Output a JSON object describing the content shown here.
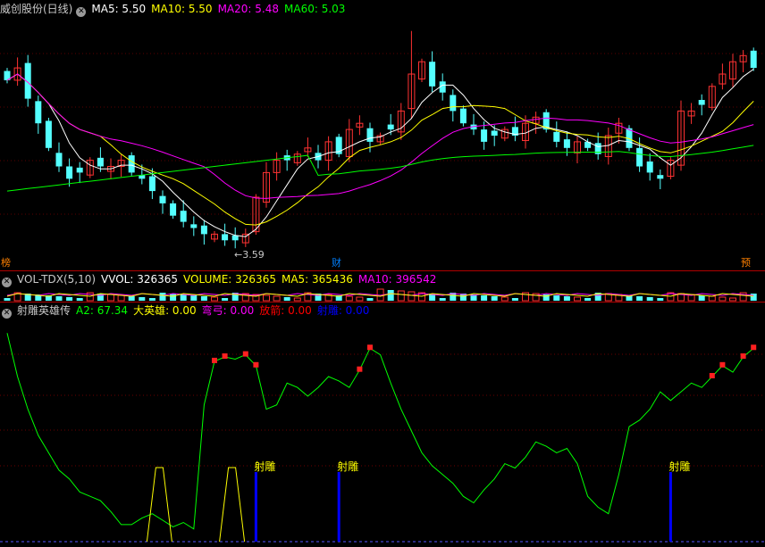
{
  "main": {
    "title": "威创股份(日线)",
    "indicators": [
      {
        "label": "MA5: 5.50",
        "color": "#ffffff"
      },
      {
        "label": "MA10: 5.50",
        "color": "#ffff00"
      },
      {
        "label": "MA20: 5.48",
        "color": "#ff00ff"
      },
      {
        "label": "MA60: 5.03",
        "color": "#00ff00"
      }
    ],
    "low_annotation": "←3.59",
    "markers": [
      {
        "label": "榜",
        "color": "#ff8000"
      },
      {
        "label": "财",
        "color": "#0080ff"
      },
      {
        "label": "预",
        "color": "#ff8000"
      }
    ]
  },
  "volume": {
    "title": "VOL-TDX(5,10)",
    "indicators": [
      {
        "label": "VVOL: 326365",
        "color": "#ffffff"
      },
      {
        "label": "VOLUME: 326365",
        "color": "#ffff00"
      },
      {
        "label": "MA5: 365436",
        "color": "#ffff00"
      },
      {
        "label": "MA10: 396542",
        "color": "#ff00ff"
      }
    ]
  },
  "indicator": {
    "title": "射雕英雄传",
    "values": [
      {
        "label": "A2: 67.34",
        "color": "#00ff00"
      },
      {
        "label": "大英雄: 0.00",
        "color": "#ffff00"
      },
      {
        "label": "弯弓: 0.00",
        "color": "#ff00ff"
      },
      {
        "label": "放箭: 0.00",
        "color": "#ff0000"
      },
      {
        "label": "射雕: 0.00",
        "color": "#0000ff"
      }
    ],
    "signal_label": "射雕"
  },
  "chart_data": [
    {
      "type": "candlestick",
      "title": "威创股份(日线)",
      "price_range": [
        3.4,
        7.4
      ],
      "annotation_low": 3.59,
      "ma_last": {
        "MA5": 5.5,
        "MA10": 5.5,
        "MA20": 5.48,
        "MA60": 5.03
      },
      "close_estimates": [
        6.3,
        6.5,
        6.0,
        5.6,
        5.2,
        4.9,
        4.7,
        4.8,
        5.0,
        4.9,
        4.9,
        5.0,
        4.8,
        4.7,
        4.5,
        4.3,
        4.1,
        4.0,
        3.9,
        3.8,
        3.8,
        3.7,
        3.7,
        3.8,
        4.4,
        4.8,
        5.0,
        5.0,
        5.1,
        5.2,
        5.0,
        5.3,
        5.1,
        5.5,
        5.6,
        5.3,
        5.4,
        5.5,
        5.8,
        6.4,
        6.6,
        6.2,
        6.1,
        5.8,
        5.6,
        5.5,
        5.3,
        5.4,
        5.5,
        5.4,
        5.6,
        5.7,
        5.5,
        5.3,
        5.2,
        5.3,
        5.2,
        5.1,
        5.4,
        5.6,
        5.2,
        4.9,
        4.8,
        4.7,
        5.0,
        5.8,
        5.8,
        5.9,
        6.2,
        6.4,
        6.6,
        6.7,
        6.5
      ]
    },
    {
      "type": "bar",
      "title": "VOL-TDX(5,10)",
      "last": {
        "VVOL": 326365,
        "VOLUME": 326365,
        "MA5": 365436,
        "MA10": 396542
      }
    },
    {
      "type": "line",
      "title": "射雕英雄传",
      "series": [
        {
          "name": "A2",
          "last": 67.34
        }
      ],
      "last": {
        "大英雄": 0.0,
        "弯弓": 0.0,
        "放箭": 0.0,
        "射雕": 0.0
      },
      "a2_estimates": [
        95,
        75,
        60,
        48,
        40,
        32,
        28,
        22,
        20,
        18,
        13,
        7,
        7,
        10,
        12,
        9,
        6,
        8,
        5,
        62,
        82,
        84,
        83,
        85,
        80,
        60,
        62,
        72,
        70,
        66,
        70,
        75,
        73,
        70,
        78,
        88,
        85,
        72,
        60,
        50,
        40,
        34,
        30,
        26,
        20,
        17,
        23,
        28,
        35,
        33,
        38,
        45,
        43,
        40,
        42,
        35,
        20,
        15,
        12,
        30,
        52,
        55,
        60,
        68,
        64,
        68,
        72,
        70,
        75,
        80,
        77,
        84,
        88
      ]
    }
  ]
}
